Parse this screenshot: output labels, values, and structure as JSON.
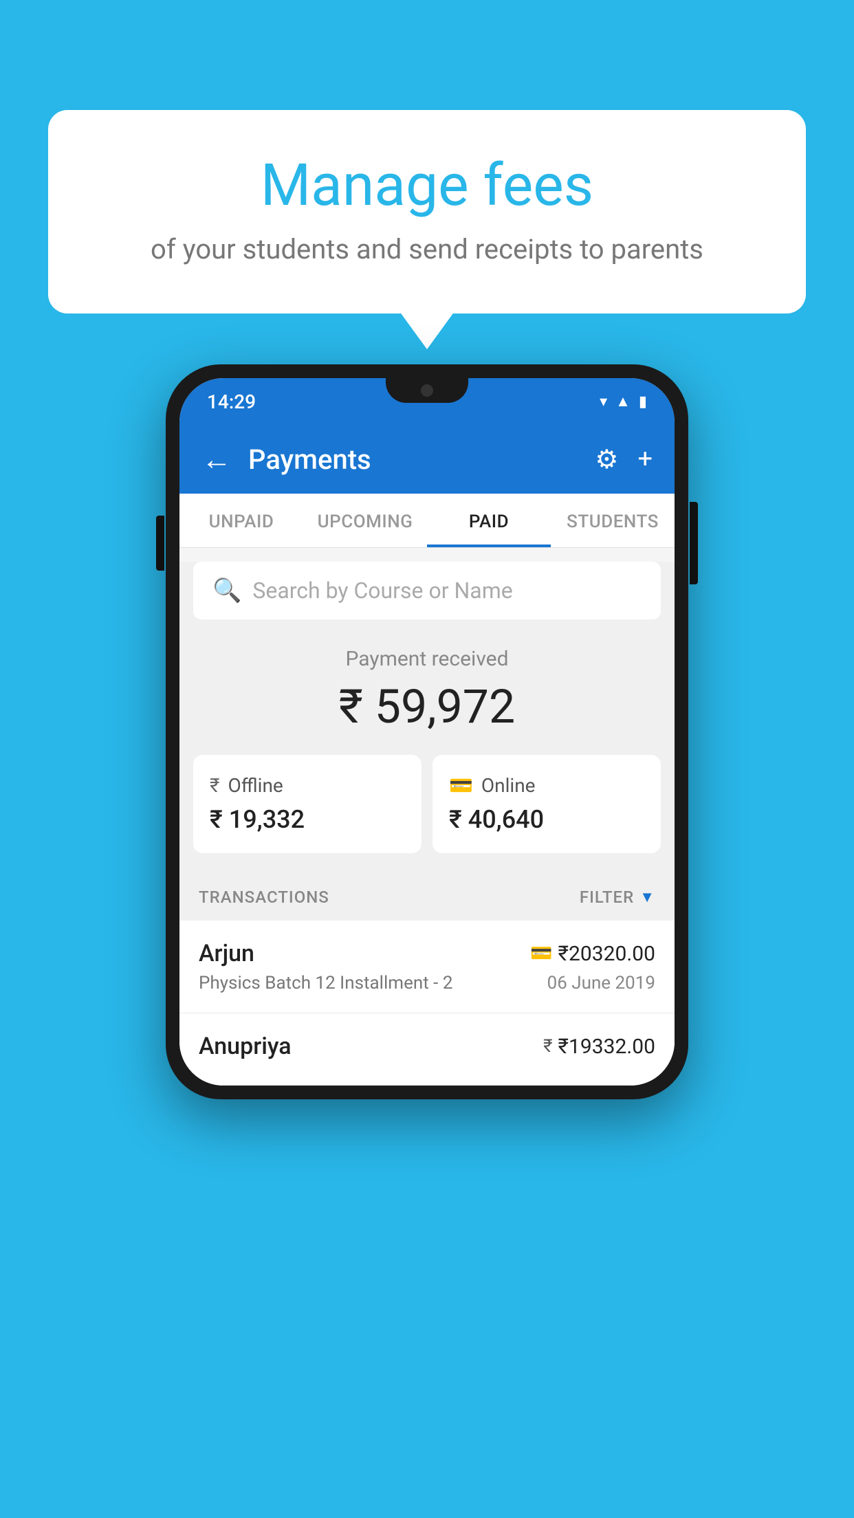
{
  "background_color": "#29B6E8",
  "speech_bubble": {
    "title": "Manage fees",
    "subtitle": "of your students and send receipts to parents"
  },
  "status_bar": {
    "time": "14:29",
    "icons": [
      "wifi",
      "signal",
      "battery"
    ]
  },
  "app_header": {
    "title": "Payments",
    "back_label": "←",
    "settings_label": "⚙",
    "add_label": "+"
  },
  "tabs": [
    {
      "label": "UNPAID",
      "active": false
    },
    {
      "label": "UPCOMING",
      "active": false
    },
    {
      "label": "PAID",
      "active": true
    },
    {
      "label": "STUDENTS",
      "active": false
    }
  ],
  "search": {
    "placeholder": "Search by Course or Name"
  },
  "payment_received": {
    "label": "Payment received",
    "amount": "₹ 59,972"
  },
  "payment_cards": [
    {
      "type": "Offline",
      "amount": "₹ 19,332",
      "icon": "₹"
    },
    {
      "type": "Online",
      "amount": "₹ 40,640",
      "icon": "💳"
    }
  ],
  "transactions_header": {
    "label": "TRANSACTIONS",
    "filter_label": "FILTER"
  },
  "transactions": [
    {
      "name": "Arjun",
      "amount": "₹20320.00",
      "course": "Physics Batch 12 Installment - 2",
      "date": "06 June 2019",
      "payment_type": "online"
    },
    {
      "name": "Anupriya",
      "amount": "₹19332.00",
      "course": "",
      "date": "",
      "payment_type": "offline"
    }
  ]
}
